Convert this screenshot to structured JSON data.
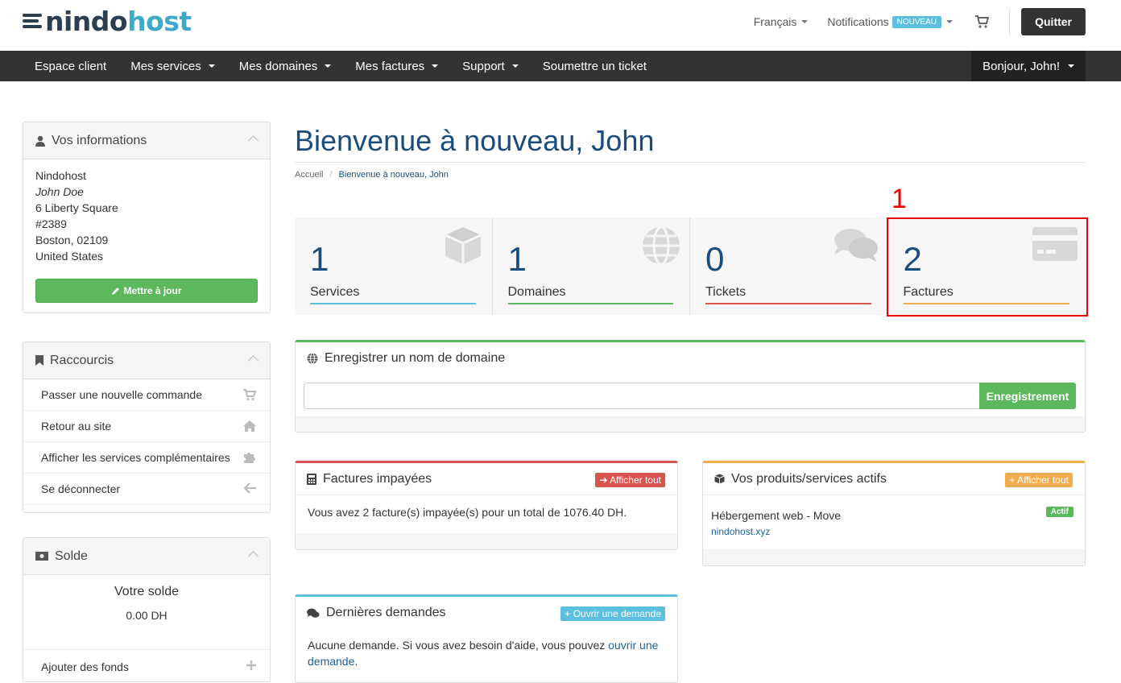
{
  "brand": {
    "part1": "nindo",
    "part2": "host"
  },
  "top": {
    "language": "Français",
    "notifications": "Notifications",
    "new_badge": "NOUVEAU",
    "quit": "Quitter"
  },
  "nav": {
    "items": [
      {
        "label": "Espace client",
        "caret": false
      },
      {
        "label": "Mes services",
        "caret": true
      },
      {
        "label": "Mes domaines",
        "caret": true
      },
      {
        "label": "Mes factures",
        "caret": true
      },
      {
        "label": "Support",
        "caret": true
      },
      {
        "label": "Soumettre un ticket",
        "caret": false
      }
    ],
    "user": "Bonjour, John!"
  },
  "sidebar": {
    "info": {
      "title": "Vos informations",
      "company": "Nindohost",
      "name": "John Doe",
      "address1": "6 Liberty Square",
      "address2": "#2389",
      "city": "Boston, 02109",
      "country": "United States",
      "update": "Mettre à jour"
    },
    "shortcuts": {
      "title": "Raccourcis",
      "items": [
        {
          "label": "Passer une nouvelle commande",
          "icon": "cart-icon"
        },
        {
          "label": "Retour au site",
          "icon": "home-icon"
        },
        {
          "label": "Afficher les services complémentaires",
          "icon": "puzzle-icon"
        },
        {
          "label": "Se déconnecter",
          "icon": "arrow-left-icon"
        }
      ]
    },
    "balance": {
      "title": "Solde",
      "label": "Votre solde",
      "value": "0.00 DH",
      "add_funds": "Ajouter des fonds"
    }
  },
  "main": {
    "title": "Bienvenue à nouveau, John",
    "breadcrumb": {
      "home": "Accueil",
      "current": "Bienvenue à nouveau, John"
    },
    "tiles": [
      {
        "value": "1",
        "label": "Services",
        "color": "#5bc0de",
        "icon": "cube-icon"
      },
      {
        "value": "1",
        "label": "Domaines",
        "color": "#5cb85c",
        "icon": "globe-icon"
      },
      {
        "value": "0",
        "label": "Tickets",
        "color": "#d9534f",
        "icon": "comments-icon"
      },
      {
        "value": "2",
        "label": "Factures",
        "color": "#f0ad4e",
        "icon": "credit-card-icon"
      }
    ],
    "annotation": "1",
    "domain": {
      "title": "Enregistrer un nom de domaine",
      "input_value": "",
      "button": "Enregistrement"
    },
    "unpaid": {
      "title": "Factures impayées",
      "button": "Afficher tout",
      "text": "Vous avez 2 facture(s) impayée(s) pour un total de 1076.40 DH."
    },
    "products": {
      "title": "Vos produits/services actifs",
      "button": "Afficher tout",
      "item_name": "Hébergement web - Move",
      "item_domain": "nindohost.xyz",
      "status": "Actif"
    },
    "tickets": {
      "title": "Dernières demandes",
      "button": "Ouvrir une demande",
      "text_before": "Aucune demande. Si vous avez besoin d'aide, vous pouvez ",
      "link": "ouvrir une demande",
      "text_after": "."
    }
  },
  "colors": {
    "primary": "#1a4d7c",
    "nav": "#333333",
    "green": "#5cb85c",
    "red": "#d9534f",
    "orange": "#f0ad4e",
    "blue": "#5bc0de",
    "annotation": "#ee0000"
  }
}
